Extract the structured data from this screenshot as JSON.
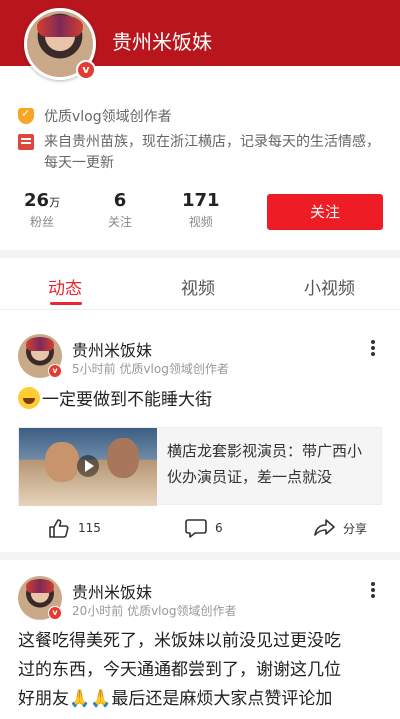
{
  "profile": {
    "name": "贵州米饭妹",
    "verify_badge": "v",
    "creator_tag": "优质vlog领域创作者",
    "bio": "来自贵州苗族，现在浙江横店，记录每天的生活情感，每天一更新"
  },
  "stats": {
    "fans_num": "26",
    "fans_unit": "万",
    "fans_label": "粉丝",
    "following_num": "6",
    "following_label": "关注",
    "videos_num": "171",
    "videos_label": "视频"
  },
  "follow_button": "关注",
  "tabs": [
    {
      "label": "动态",
      "active": true
    },
    {
      "label": "视频",
      "active": false
    },
    {
      "label": "小视频",
      "active": false
    }
  ],
  "posts": [
    {
      "author": "贵州米饭妹",
      "meta": "5小时前  优质vlog领域创作者",
      "text": "一定要做到不能睡大街",
      "link_title": "横店龙套影视演员：带广西小伙办演员证，差一点就没",
      "likes": "115",
      "comments": "6",
      "share": "分享"
    },
    {
      "author": "贵州米饭妹",
      "meta": "20小时前  优质vlog领域创作者",
      "text_line1": "这餐吃得美死了，米饭妹以前没见过更没吃",
      "text_line2": "过的东西，今天通通都尝到了，谢谢这几位",
      "text_line3a": "好朋友",
      "text_line3b": "最后还是麻烦大家点赞评论加"
    }
  ],
  "colors": {
    "header": "#b8161c",
    "accent": "#ee1c25",
    "tab_active": "#e8282e"
  }
}
